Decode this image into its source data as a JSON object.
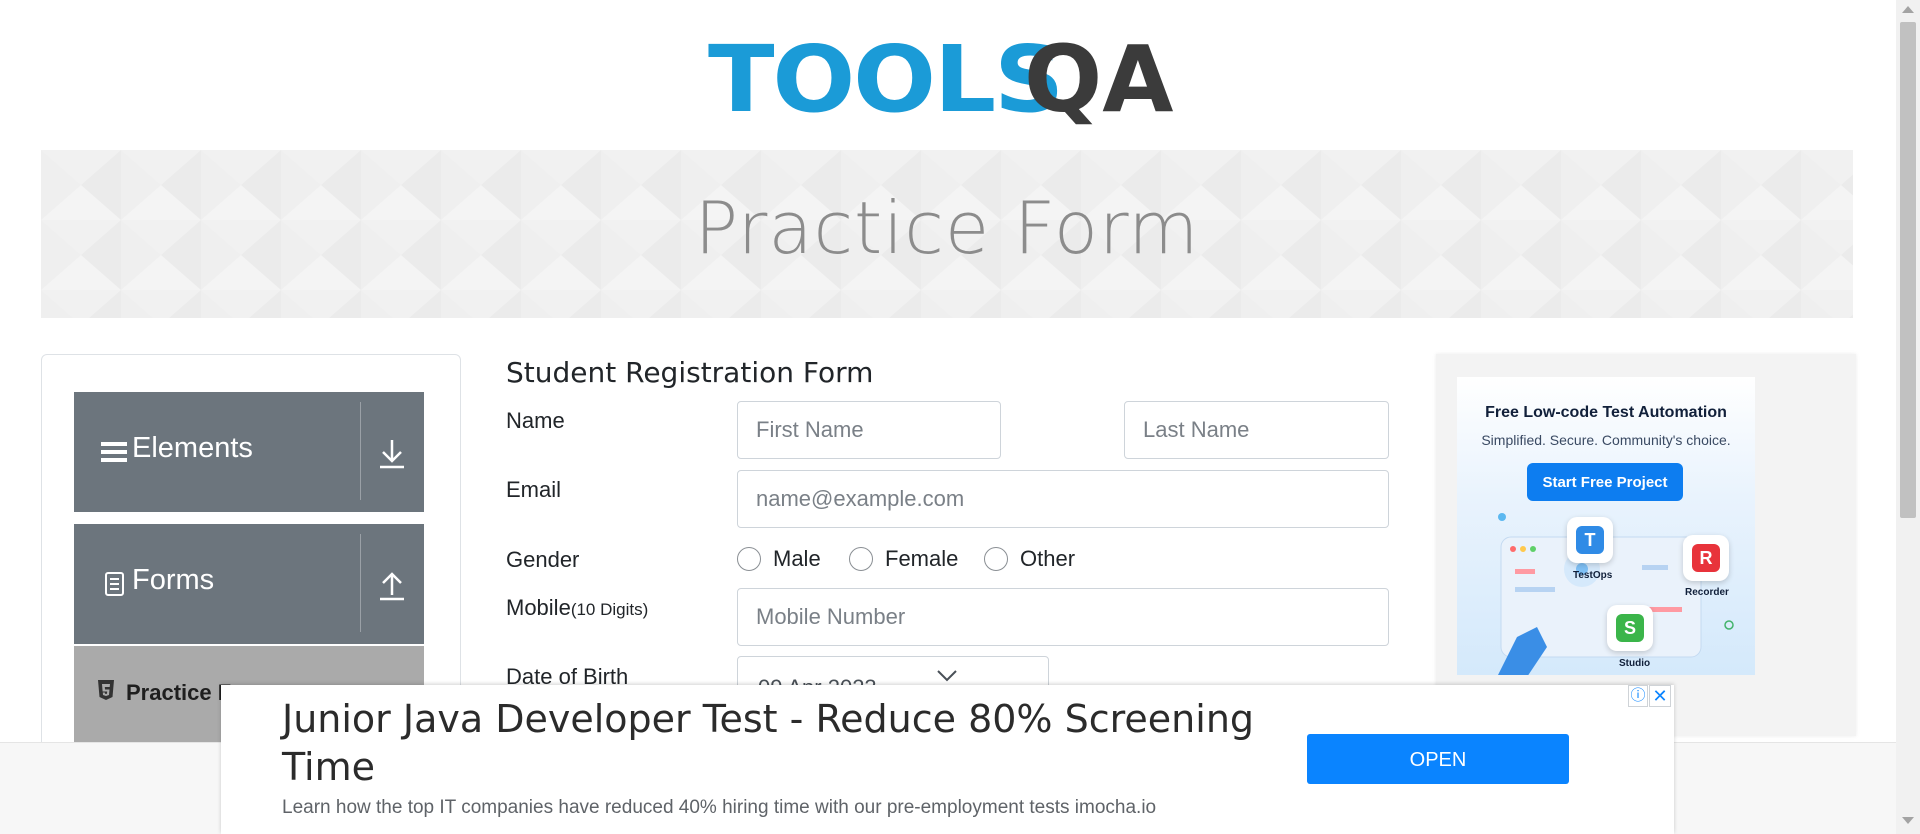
{
  "header": {
    "logo_text": "TOOLS",
    "logo_qa": "QA"
  },
  "banner": {
    "title": "Practice Form"
  },
  "sidebar": {
    "groups": [
      {
        "label": "Elements",
        "icon": "hamburger-icon",
        "chevron": "download-arrow-icon"
      },
      {
        "label": "Forms",
        "icon": "document-icon",
        "chevron": "upload-arrow-icon"
      }
    ],
    "active_item": {
      "label": "Practice F",
      "icon": "html5-shield-icon"
    }
  },
  "form": {
    "title": "Student Registration Form",
    "name_label": "Name",
    "first_name_placeholder": "First Name",
    "last_name_placeholder": "Last Name",
    "email_label": "Email",
    "email_placeholder": "name@example.com",
    "gender_label": "Gender",
    "gender_options": [
      "Male",
      "Female",
      "Other"
    ],
    "mobile_label": "Mobile",
    "mobile_hint": "(10 Digits)",
    "mobile_placeholder": "Mobile Number",
    "dob_label": "Date of Birth",
    "dob_value": "09 Apr 2023"
  },
  "side_ad": {
    "headline": "Free Low-code Test Automation",
    "subline": "Simplified. Secure. Community's choice.",
    "cta": "Start Free Project",
    "tiles": [
      "TestOps",
      "Recorder",
      "Studio"
    ]
  },
  "bottom_ad": {
    "headline": "Junior Java Developer Test - Reduce 80% Screening Time",
    "description": "Learn how the top IT companies have reduced 40% hiring time with our pre-employment tests imocha.io",
    "cta": "OPEN",
    "info_glyph": "ⓘ",
    "close_glyph": "✕"
  },
  "colors": {
    "logo_blue": "#1b9bd7",
    "logo_dark": "#3b3b3b",
    "sidebar_header": "#6c757d",
    "sidebar_active": "#aaaaaa",
    "ad_button": "#0a84ff"
  }
}
